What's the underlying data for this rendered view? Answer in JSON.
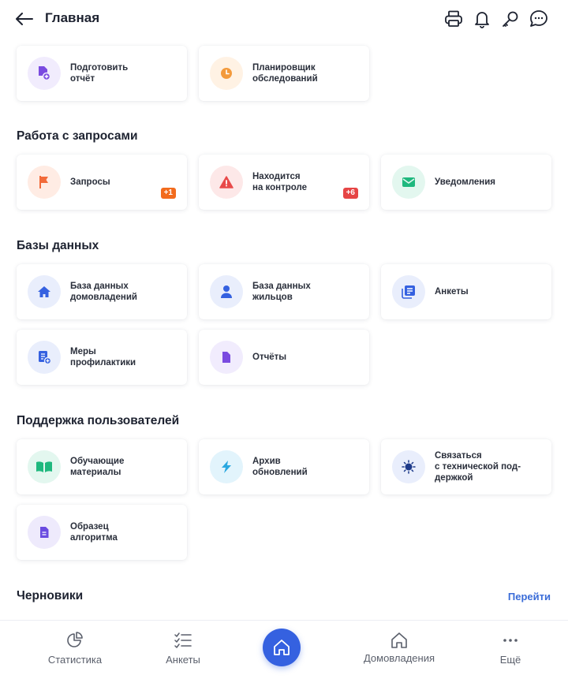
{
  "header": {
    "title": "Главная",
    "icons": [
      "back-arrow-icon",
      "printer-icon",
      "bell-icon",
      "key-icon",
      "chat-icon"
    ]
  },
  "top_cards": [
    {
      "label": "Подготовить\nотчёт",
      "icon": "report-add-icon",
      "color": "#7a4be0",
      "bg": "#f1ecfd"
    },
    {
      "label": "Планировщик\nобследований",
      "icon": "clock-icon",
      "color": "#f39a3c",
      "bg": "#fff2e4"
    }
  ],
  "requests": {
    "title": "Работа с запросами",
    "cards": [
      {
        "label": "Запросы",
        "icon": "flag-icon",
        "color": "#f26b3a",
        "bg": "#ffece4",
        "badge": "+1",
        "badge_color": "#f26b1d"
      },
      {
        "label": "Находится\nна контроле",
        "icon": "warning-icon",
        "color": "#e84a4a",
        "bg": "#fde8e8",
        "badge": "+6",
        "badge_color": "#e64545"
      },
      {
        "label": "Уведомления",
        "icon": "mail-icon",
        "color": "#1fb87e",
        "bg": "#e3f7ef"
      }
    ]
  },
  "databases": {
    "title": "Базы данных",
    "cards": [
      {
        "label": "База данных\nдомовладений",
        "icon": "house-icon",
        "color": "#3561e0",
        "bg": "#e9eefc"
      },
      {
        "label": "База данных\nжильцов",
        "icon": "person-icon",
        "color": "#3561e0",
        "bg": "#e9eefc"
      },
      {
        "label": "Анкеты",
        "icon": "forms-icon",
        "color": "#3561e0",
        "bg": "#e9eefc"
      },
      {
        "label": "Меры\nпрофилактики",
        "icon": "document-add-icon",
        "color": "#3561e0",
        "bg": "#e9eefc"
      },
      {
        "label": "Отчёты",
        "icon": "file-icon",
        "color": "#7a4be0",
        "bg": "#f1ecfd"
      }
    ]
  },
  "support": {
    "title": "Поддержка пользователей",
    "cards": [
      {
        "label": "Обучающие\nматериалы",
        "icon": "book-icon",
        "color": "#1fb87e",
        "bg": "#e3f7ef"
      },
      {
        "label": "Архив\nобновлений",
        "icon": "lightning-icon",
        "color": "#2aa8e0",
        "bg": "#e2f4fc"
      },
      {
        "label": "Связаться\nс технической под-\nдержкой",
        "icon": "bulb-icon",
        "color": "#1d3a8a",
        "bg": "#e9eefc"
      },
      {
        "label": "Образец\nалгоритма",
        "icon": "doc-lines-icon",
        "color": "#6a4be0",
        "bg": "#eeeafc"
      }
    ]
  },
  "drafts": {
    "title": "Черновики",
    "link": "Перейти"
  },
  "bottom_nav": {
    "items": [
      {
        "label": "Статистика",
        "icon": "pie-chart-icon"
      },
      {
        "label": "Анкеты",
        "icon": "checklist-icon"
      },
      {
        "label": "",
        "icon": "home-icon"
      },
      {
        "label": "Домовладения",
        "icon": "house-outline-icon"
      },
      {
        "label": "Ещё",
        "icon": "dots-icon"
      }
    ],
    "active_color": "#3561e0"
  }
}
